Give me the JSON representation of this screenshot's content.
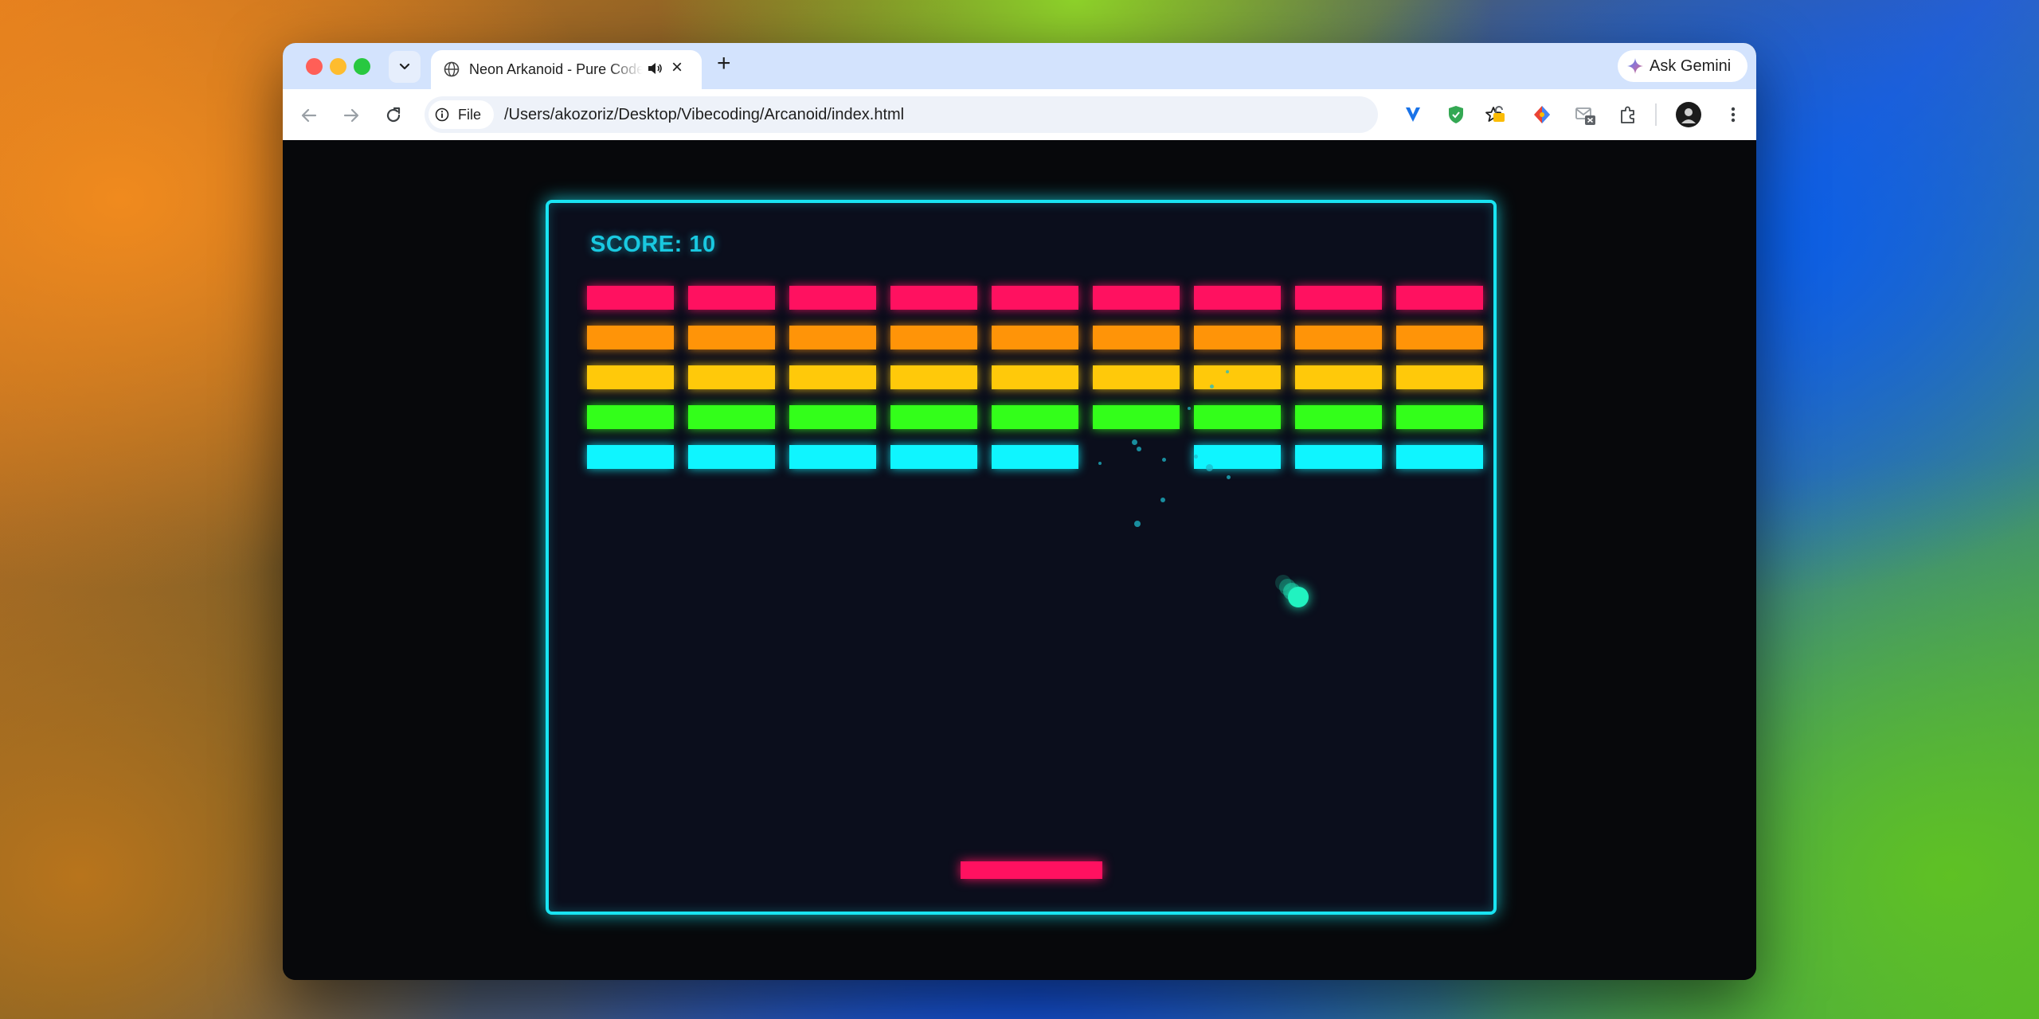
{
  "browser": {
    "tab_title": "Neon Arkanoid - Pure Code",
    "ask_gemini_label": "Ask Gemini",
    "site_info_label": "File",
    "url": "/Users/akozoriz/Desktop/Vibecoding/Arcanoid/index.html",
    "icons": {
      "tab_favicon": "globe-icon",
      "tab_audio": "speaker-icon",
      "tab_close": "close-icon",
      "new_tab": "plus-icon",
      "tab_list": "chevron-down-icon",
      "back": "arrow-left-icon",
      "forward": "arrow-right-icon",
      "reload": "reload-icon",
      "bookmark": "star-icon",
      "menu": "more-vertical-icon"
    },
    "extensions": [
      "v-extension-icon",
      "shield-extension-icon",
      "lock-extension-icon",
      "color-extension-icon",
      "mail-x-extension-icon",
      "puzzle-icon",
      "avatar"
    ]
  },
  "game": {
    "score_label": "SCORE: 10",
    "colors": {
      "border": "#19e4f2",
      "score": "#19c9e0",
      "paddle": "#ff1160",
      "ball": "#21f2c0"
    },
    "brick_rows": [
      {
        "color": "#ff1160",
        "bricks": [
          1,
          1,
          1,
          1,
          1,
          1,
          1,
          1,
          1
        ]
      },
      {
        "color": "#ff9408",
        "bricks": [
          1,
          1,
          1,
          1,
          1,
          1,
          1,
          1,
          1
        ]
      },
      {
        "color": "#ffc90a",
        "bricks": [
          1,
          1,
          1,
          1,
          1,
          1,
          1,
          1,
          1
        ]
      },
      {
        "color": "#33ff1a",
        "bricks": [
          1,
          1,
          1,
          1,
          1,
          1,
          1,
          1,
          1
        ]
      },
      {
        "color": "#0ff5ff",
        "bricks": [
          1,
          1,
          1,
          1,
          1,
          0,
          1,
          1,
          1
        ]
      }
    ]
  }
}
